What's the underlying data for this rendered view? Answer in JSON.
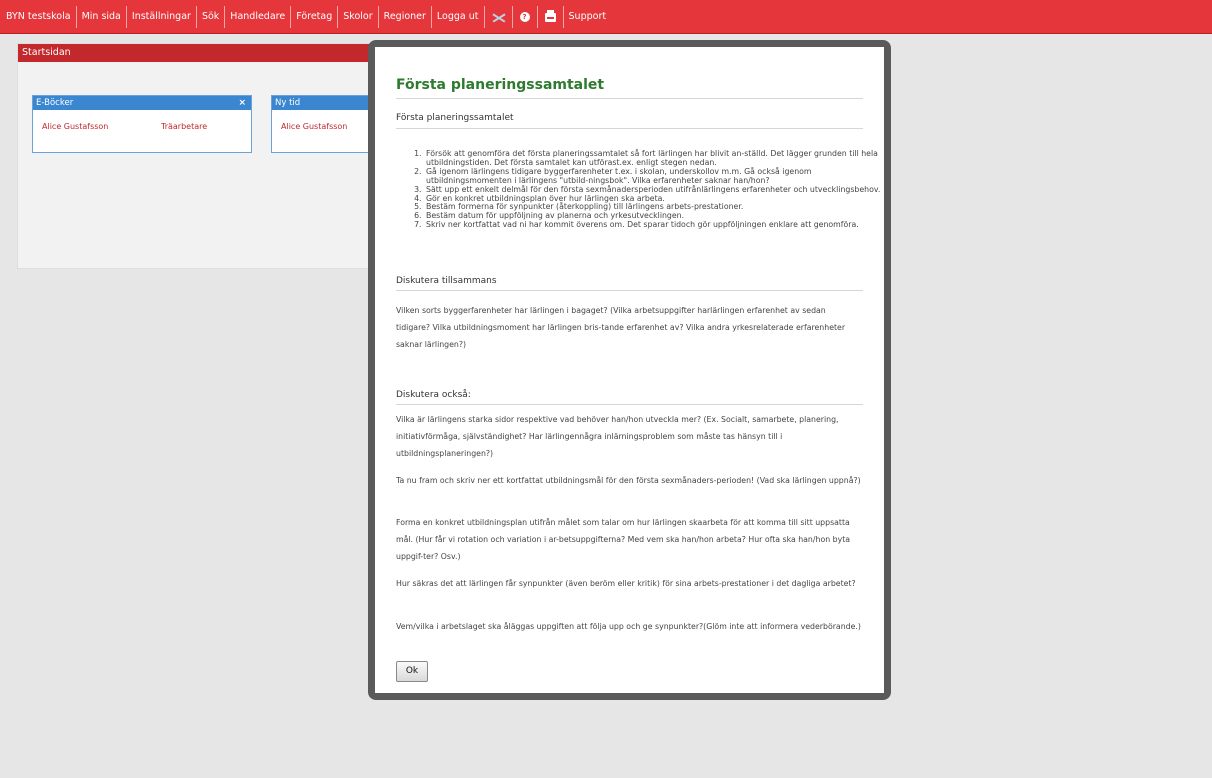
{
  "nav": {
    "items": [
      "BYN testskola",
      "Min sida",
      "Inställningar",
      "Sök",
      "Handledare",
      "Företag",
      "Skolor",
      "Regioner",
      "Logga ut"
    ],
    "icons": [
      "mail-icon",
      "help-icon",
      "print-icon"
    ],
    "support": "Support"
  },
  "start": {
    "title": "Startsidan",
    "widget_ebook": {
      "title": "E-Böcker",
      "close": "×",
      "name": "Alice Gustafsson",
      "role": "Träarbetare"
    },
    "widget_newtime": {
      "title": "Ny tid",
      "name": "Alice Gustafsson"
    }
  },
  "modal": {
    "title": "Första planeringssamtalet",
    "section1": "Första planeringssamtalet",
    "steps": [
      "Försök att genomföra det första planeringssamtalet så fort lärlingen har blivit an-ställd. Det lägger grunden till hela utbildningstiden. Det första samtalet kan utförast.ex. enligt stegen nedan.",
      "Gå igenom lärlingens tidigare byggerfarenheter t.ex. i skolan, underskollov m.m. Gå också igenom utbildningsmomenten i lärlingens \"utbild-ningsbok\". Vilka erfarenheter saknar han/hon?",
      "Sätt upp ett enkelt delmål för den första sexmånadersperioden utifrånlärlingens erfarenheter och utvecklingsbehov.",
      "Gör en konkret utbildningsplan över hur lärlingen ska arbeta.",
      "Bestäm formerna för synpunkter (återkoppling) till lärlingens arbets-prestationer.",
      "Bestäm datum för uppföljning av planerna och yrkesutvecklingen.",
      "Skriv ner kortfattat vad ni har kommit överens om. Det sparar tidoch gör uppföljningen enklare att genomföra."
    ],
    "section2": "Diskutera tillsammans",
    "para2": "Vilken sorts byggerfarenheter har lärlingen i bagaget? (Vilka arbetsuppgifter harlärlingen erfarenhet av sedan tidigare? Vilka utbildningsmoment har lärlingen bris-tande erfarenhet av? Vilka andra yrkesrelaterade erfarenheter saknar lärlingen?)",
    "section3": "Diskutera också:",
    "para3a": "Vilka är lärlingens starka sidor respektive vad behöver han/hon utveckla mer? (Ex. Socialt, samarbete, planering, initiativförmåga, självständighet? Har lärlingennågra inlärningsproblem som måste tas hänsyn till i utbildningsplaneringen?)",
    "para3b": "Ta nu fram och skriv ner ett kortfattat utbildningsmål för den första sexmånaders-perioden! (Vad ska lärlingen uppnå?)",
    "para3c": "Forma en konkret utbildningsplan utifrån målet som talar om hur lärlingen skaarbeta för att komma till sitt uppsatta mål. (Hur får vi rotation och variation i ar-betsuppgifterna? Med vem ska han/hon arbeta? Hur ofta ska han/hon byta uppgif-ter? Osv.)",
    "para3d": "Hur säkras det att lärlingen får synpunkter (även beröm eller kritik) för sina arbets-prestationer i det dagliga arbetet?",
    "para3e": "Vem/vilka i arbetslaget ska åläggas uppgiften att följa upp och ge synpunkter?(Glöm inte att informera vederbörande.)",
    "ok": "Ok"
  }
}
